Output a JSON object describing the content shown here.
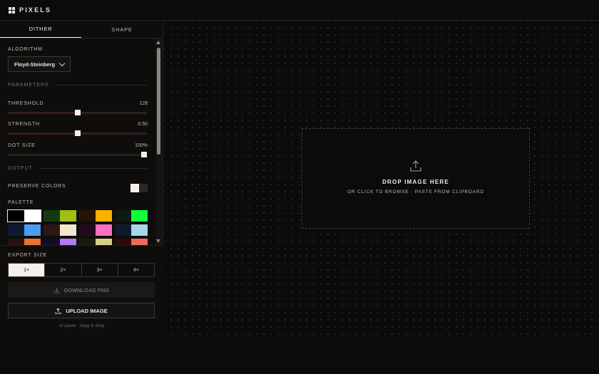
{
  "app": {
    "brand": "PIXELS"
  },
  "tabs": [
    {
      "label": "DITHER",
      "active": true
    },
    {
      "label": "SHAPE",
      "active": false
    }
  ],
  "algorithm": {
    "label": "ALGORITHM",
    "value": "Floyd-Steinberg"
  },
  "parameters": {
    "section": "PARAMETERS",
    "threshold": {
      "label": "THRESHOLD",
      "value": "128",
      "level": 0.502
    },
    "strength": {
      "label": "STRENGTH",
      "value": "0.50",
      "level": 0.5
    },
    "dot_size": {
      "label": "DOT SIZE",
      "value": "100%",
      "level": 1.0
    }
  },
  "output": {
    "section": "OUTPUT",
    "preserve_colors": {
      "label": "PRESERVE COLORS",
      "on": true
    },
    "palette_label": "PALETTE",
    "palettes": [
      [
        "#000000",
        "#ffffff"
      ],
      [
        "#133a0f",
        "#9fbf12"
      ],
      [
        "#241408",
        "#ffb000"
      ],
      [
        "#0b1a0e",
        "#12ff3a"
      ],
      [
        "#0f1a30",
        "#4a9cf0"
      ],
      [
        "#2b1814",
        "#f2e6cf"
      ],
      [
        "#220a1c",
        "#ff6fc1"
      ],
      [
        "#0e1a2e",
        "#a6d6e8"
      ],
      [
        "#24140c",
        "#e8722e"
      ],
      [
        "#140a2a",
        "#b07cf0"
      ],
      [
        "#1a1a0a",
        "#d6cf8a"
      ],
      [
        "#2a0c0c",
        "#f06a5a"
      ]
    ],
    "selected_palette": 0
  },
  "export": {
    "label": "EXPORT SIZE",
    "sizes": [
      "1×",
      "2×",
      "3×",
      "4×"
    ],
    "selected_size": 0,
    "download_label": "DOWNLOAD PNG",
    "upload_label": "UPLOAD IMAGE",
    "hint": "or paste · drag & drop"
  },
  "dropzone": {
    "title": "DROP IMAGE HERE",
    "subtitle": "OR CLICK TO BROWSE · PASTE FROM CLIPBOARD"
  }
}
